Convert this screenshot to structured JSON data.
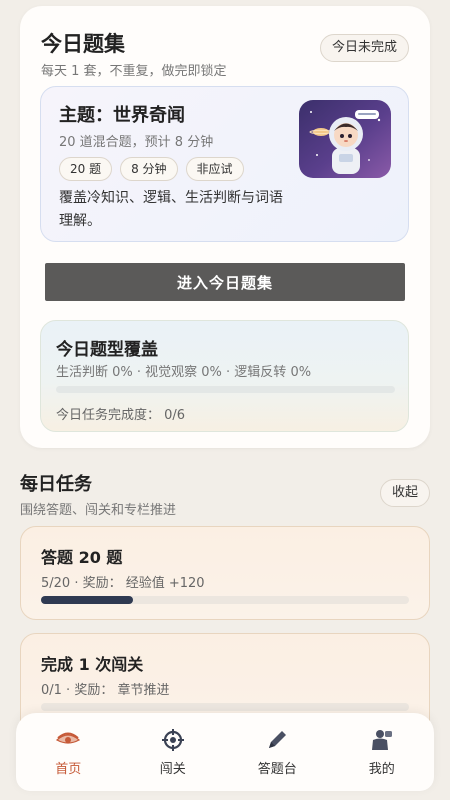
{
  "header": {
    "title": "今日题集",
    "subtitle": "每天 1 套，不重复，做完即锁定",
    "status": "今日未完成"
  },
  "theme_card": {
    "title": "主题：世界奇闻",
    "subtitle": "20 道混合题，预计 8 分钟",
    "tags": [
      "20 题",
      "8 分钟",
      "非应试"
    ],
    "description": "覆盖冷知识、逻辑、生活判断与词语理解。",
    "image_icon": "astronaut-illustration"
  },
  "enter_button": "进入今日题集",
  "coverage": {
    "title": "今日题型覆盖",
    "subtitle": "生活判断 0% · 视觉观察 0% · 逻辑反转 0%",
    "progress_fraction": 0,
    "progress_text": "今日任务完成度： 0/6"
  },
  "daily": {
    "title": "每日任务",
    "subtitle": "围绕答题、闯关和专栏推进",
    "collapse": "收起",
    "tasks": [
      {
        "title": "答题 20 题",
        "meta": "5/20 · 奖励： 经验值 +120",
        "progress_fraction": 0.25
      },
      {
        "title": "完成 1 次闯关",
        "meta": "0/1 · 奖励： 章节推进",
        "progress_fraction": 0
      }
    ]
  },
  "nav": {
    "items": [
      {
        "label": "首页",
        "icon": "eye-icon",
        "active": true
      },
      {
        "label": "闯关",
        "icon": "target-icon",
        "active": false
      },
      {
        "label": "答题台",
        "icon": "pen-icon",
        "active": false
      },
      {
        "label": "我的",
        "icon": "profile-icon",
        "active": false
      }
    ]
  },
  "colors": {
    "accent": "#c65a38",
    "button": "#5b5a59",
    "progress_dark": "#2f3a52",
    "background": "#f2eee8"
  }
}
